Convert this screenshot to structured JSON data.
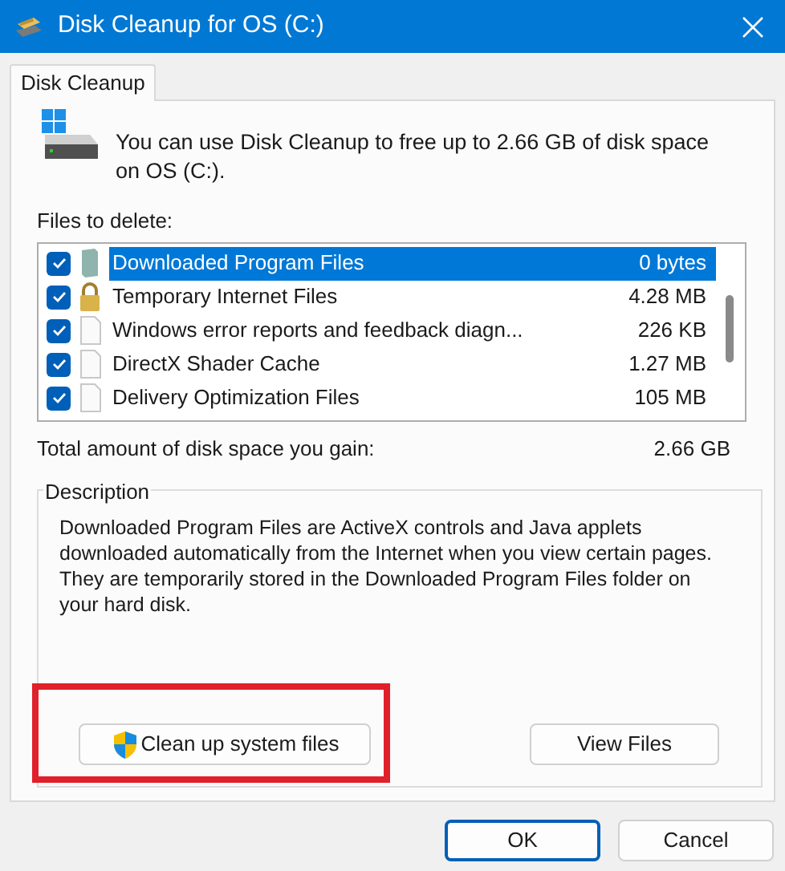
{
  "window": {
    "title": "Disk Cleanup for OS (C:)"
  },
  "tabs": [
    {
      "label": "Disk Cleanup",
      "selected": true
    }
  ],
  "intro": "You can use Disk Cleanup to free up to 2.66 GB of disk space on OS (C:).",
  "files_label": "Files to delete:",
  "files": [
    {
      "name": "Downloaded Program Files",
      "size": "0 bytes",
      "checked": true,
      "selected": true,
      "kind": "package"
    },
    {
      "name": "Temporary Internet Files",
      "size": "4.28 MB",
      "checked": true,
      "selected": false,
      "kind": "lock"
    },
    {
      "name": "Windows error reports and feedback diagn...",
      "size": "226 KB",
      "checked": true,
      "selected": false,
      "kind": "file"
    },
    {
      "name": "DirectX Shader Cache",
      "size": "1.27 MB",
      "checked": true,
      "selected": false,
      "kind": "file"
    },
    {
      "name": "Delivery Optimization Files",
      "size": "105 MB",
      "checked": true,
      "selected": false,
      "kind": "file"
    }
  ],
  "total": {
    "label": "Total amount of disk space you gain:",
    "value": "2.66 GB"
  },
  "description": {
    "legend": "Description",
    "text": "Downloaded Program Files are ActiveX controls and Java applets downloaded automatically from the Internet when you view certain pages. They are temporarily stored in the Downloaded Program Files folder on your hard disk."
  },
  "clean_button": "Clean up system files",
  "view_button": "View Files",
  "buttons": [
    {
      "label": "OK",
      "default": true
    },
    {
      "label": "Cancel",
      "default": false
    }
  ]
}
